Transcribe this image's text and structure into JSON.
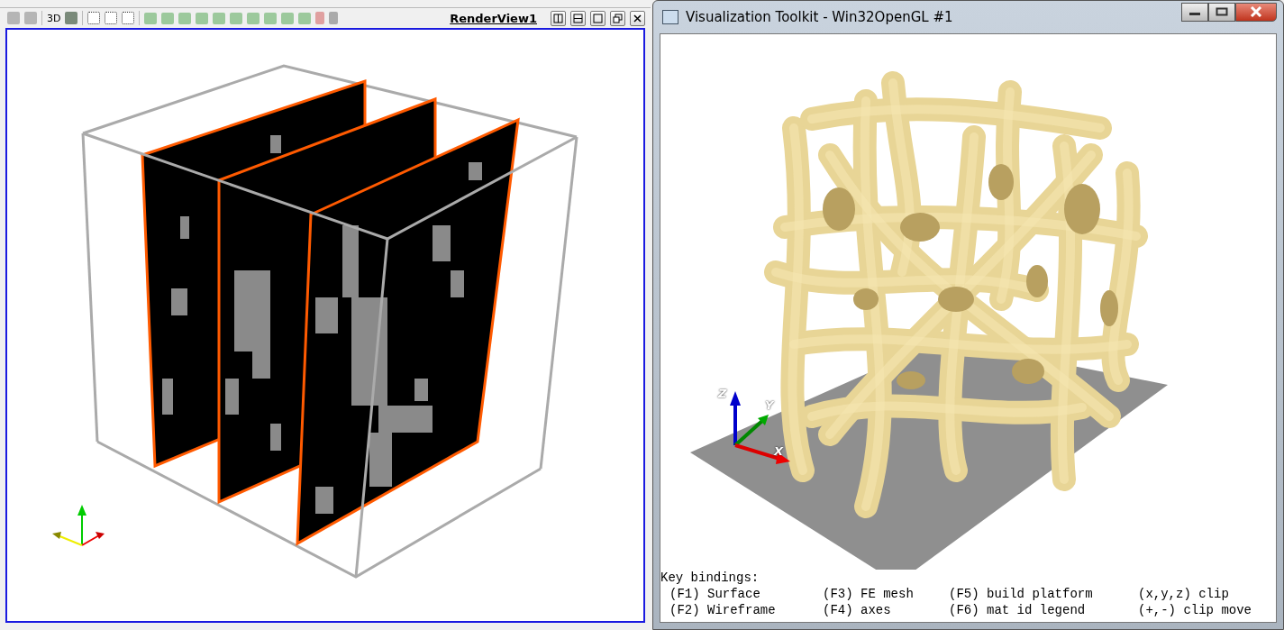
{
  "left_view": {
    "toolbar": {
      "label_3d": "3D"
    },
    "view_title": "RenderView1"
  },
  "vtk_window": {
    "title": "Visualization Toolkit - Win32OpenGL #1",
    "axes": {
      "x": "X",
      "y": "Y",
      "z": "Z"
    },
    "key_bindings": {
      "title": "Key bindings:",
      "rows": [
        [
          "(F1) Surface",
          "(F3) FE mesh",
          "(F5) build platform",
          "(x,y,z) clip"
        ],
        [
          "(F2) Wireframe",
          "(F4) axes",
          "(F6) mat id legend",
          "(+,-) clip move"
        ]
      ]
    }
  }
}
